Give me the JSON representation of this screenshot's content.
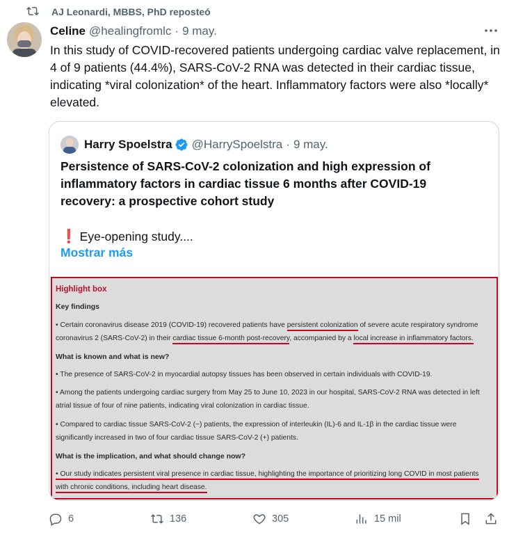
{
  "repost": {
    "text": "AJ Leonardi, MBBS, PhD reposteó"
  },
  "tweet": {
    "display_name": "Celine",
    "handle": "@healingfromlc",
    "separator": "·",
    "date": "9 may.",
    "text": "In this study of COVID-recovered patients undergoing cardiac valve replacement, in 4 of 9 patients (44.4%), SARS-CoV-2 RNA was detected in their cardiac tissue, indicating *viral colonization* of the heart. Inflammatory factors were also *locally* elevated."
  },
  "quote": {
    "display_name": "Harry Spoelstra",
    "handle": "@HarrySpoelstra",
    "separator": "·",
    "date": "9 may.",
    "headline": "Persistence of SARS-CoV-2 colonization and high expression of inflammatory factors in cardiac tissue 6 months after COVID-19 recovery: a prospective cohort study",
    "exclamation": "❗",
    "teaser": "Eye-opening study....",
    "show_more": "Mostrar más",
    "highlight_box": {
      "title": "Highlight box",
      "key_findings_heading": "Key findings",
      "kf_line1_pre": "• Certain coronavirus disease 2019 (COVID-19) recovered patients have ",
      "kf_line1_ul": "persistent colonization",
      "kf_line1_post": " of severe acute respiratory syndrome",
      "kf_line2_pre": "coronavirus 2 (SARS-CoV-2) in their ",
      "kf_line2_ul1": "cardiac tissue 6-month post-recovery",
      "kf_line2_mid": ", accompanied by a ",
      "kf_line2_ul2": "local increase in inflammatory factors.",
      "known_heading": "What is known and what is new?",
      "known1": "• The presence of SARS-CoV-2 in myocardial autopsy tissues has been observed in certain individuals with COVID-19.",
      "known2_line1": "• Among the patients undergoing cardiac surgery from May 25 to June 10, 2023 in our hospital, SARS-CoV-2 RNA was detected in left",
      "known2_line2": "atrial tissue of four of nine patients, indicating viral colonization in cardiac tissue.",
      "known3_line1": "• Compared to cardiac tissue SARS-CoV-2 (−) patients, the expression of interleukin (IL)-6 and IL-1β in the cardiac tissue were",
      "known3_line2": "significantly increased in two of four cardiac tissue SARS-CoV-2 (+) patients.",
      "implication_heading": "What is the implication, and what should change now?",
      "impl_line1": "• Our study indicates persistent viral presence in cardiac tissue, highlighting the importance of prioritizing long COVID in most patients",
      "impl_line2": "with chronic conditions, including heart disease."
    }
  },
  "actions": {
    "replies": "6",
    "reposts": "136",
    "likes": "305",
    "views": "15 mil"
  },
  "colors": {
    "accent": "#1d9bf0",
    "highlight_border": "#d0001f",
    "highlight_title": "#b5122b",
    "muted_text": "#536471"
  },
  "icons": [
    "repost-icon",
    "more-icon",
    "verified-badge-icon",
    "reply-icon",
    "retweet-icon",
    "like-icon",
    "views-icon",
    "bookmark-icon",
    "share-icon"
  ]
}
